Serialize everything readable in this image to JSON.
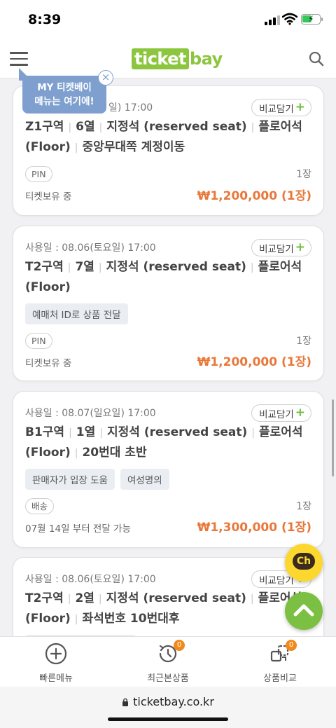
{
  "status_bar": {
    "time": "8:39"
  },
  "header": {
    "logo_ticket": "ticket",
    "logo_bay": "bay"
  },
  "tooltip": {
    "line1": "MY 티켓베이",
    "line2": "메뉴는 여기에!",
    "close": "×"
  },
  "compare_label": "비교담기",
  "listings": [
    {
      "date": "사용일 : 08.06(토요일) 17:00",
      "date_visible": "일) 17:00",
      "zone": "Z1구역",
      "row": "6열",
      "seat_type": "지정석 (reserved seat)",
      "floor": "플로어석 (Floor)",
      "note": "중앙무대쪽 계정이동",
      "tags": [],
      "method": "PIN",
      "quantity": "1장",
      "status": "티켓보유 중",
      "price": "₩1,200,000 (1장)"
    },
    {
      "date": "사용일 : 08.06(토요일) 17:00",
      "zone": "T2구역",
      "row": "7열",
      "seat_type": "지정석 (reserved seat)",
      "floor": "플로어석 (Floor)",
      "note": "",
      "tags": [
        "예매처 ID로 상품 전달"
      ],
      "method": "PIN",
      "quantity": "1장",
      "status": "티켓보유 중",
      "price": "₩1,200,000 (1장)"
    },
    {
      "date": "사용일 : 08.07(일요일) 17:00",
      "zone": "B1구역",
      "row": "1열",
      "seat_type": "지정석 (reserved seat)",
      "floor": "플로어석 (Floor)",
      "note": "20번대 초반",
      "tags": [
        "판매자가 입장 도움",
        "여성명의"
      ],
      "method": "배송",
      "quantity": "1장",
      "status": "07월 14일 부터 전달 가능",
      "price": "₩1,300,000 (1장)"
    },
    {
      "date": "사용일 : 08.06(토요일) 17:00",
      "zone": "T2구역",
      "row": "2열",
      "seat_type": "지정석 (reserved seat)",
      "floor": "플로어석 (Floor)",
      "note": "좌석번호 10번대후",
      "tags": [],
      "method": "",
      "quantity": "",
      "status": "",
      "price": ""
    }
  ],
  "floating": {
    "channel_label": "Ch",
    "top_icon": "chevron-up-icon"
  },
  "bottom_nav": [
    {
      "label": "빠른메뉴",
      "icon": "plus-circle-icon"
    },
    {
      "label": "최근본상품",
      "icon": "history-icon",
      "badge": "0"
    },
    {
      "label": "상품비교",
      "icon": "compare-icon",
      "badge": "0"
    }
  ],
  "browser": {
    "url": "ticketbay.co.kr"
  },
  "colors": {
    "brand": "#8cc63f",
    "price": "#e8783a",
    "tooltip": "#7fa0cf",
    "badge": "#f08a1c"
  }
}
